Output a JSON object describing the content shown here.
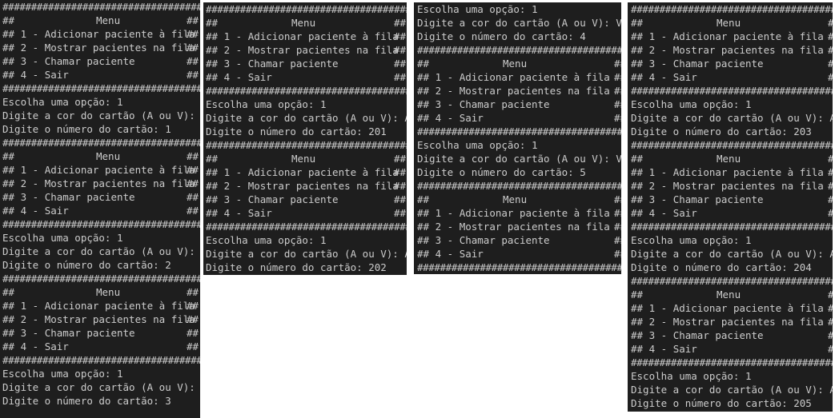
{
  "menu": {
    "title": "Menu",
    "border": "#############################################",
    "edge": "##",
    "options": [
      "1 - Adicionar paciente à fila",
      "2 - Mostrar pacientes na fila",
      "3 - Chamar paciente",
      "4 - Sair"
    ]
  },
  "prompts": {
    "option": "Escolha uma opção:",
    "color": "Digite a cor do cartão (A ou V):",
    "number": "Digite o número do cartão:"
  },
  "terminals": [
    {
      "name": "terminal-1",
      "entries": [
        {
          "choice": "1",
          "color": "V",
          "number": "1"
        },
        {
          "choice": "1",
          "color": "V",
          "number": "2"
        },
        {
          "choice": "1",
          "color": "V",
          "number": "3"
        }
      ]
    },
    {
      "name": "terminal-2",
      "entries": [
        {
          "choice": "1",
          "color": "A",
          "number": "201"
        },
        {
          "choice": "1",
          "color": "A",
          "number": "202"
        }
      ]
    },
    {
      "name": "terminal-3",
      "entries": [
        {
          "choice": "1",
          "color": "V",
          "number": "4"
        },
        {
          "choice": "1",
          "color": "V",
          "number": "5"
        }
      ]
    },
    {
      "name": "terminal-4",
      "entries": [
        {
          "choice": "1",
          "color": "A",
          "number": "203"
        },
        {
          "choice": "1",
          "color": "A",
          "number": "204"
        },
        {
          "choice": "1",
          "color": "A",
          "number": "205"
        }
      ]
    }
  ],
  "colors": {
    "background": "#1e1e1e",
    "text": "#cccccc"
  }
}
